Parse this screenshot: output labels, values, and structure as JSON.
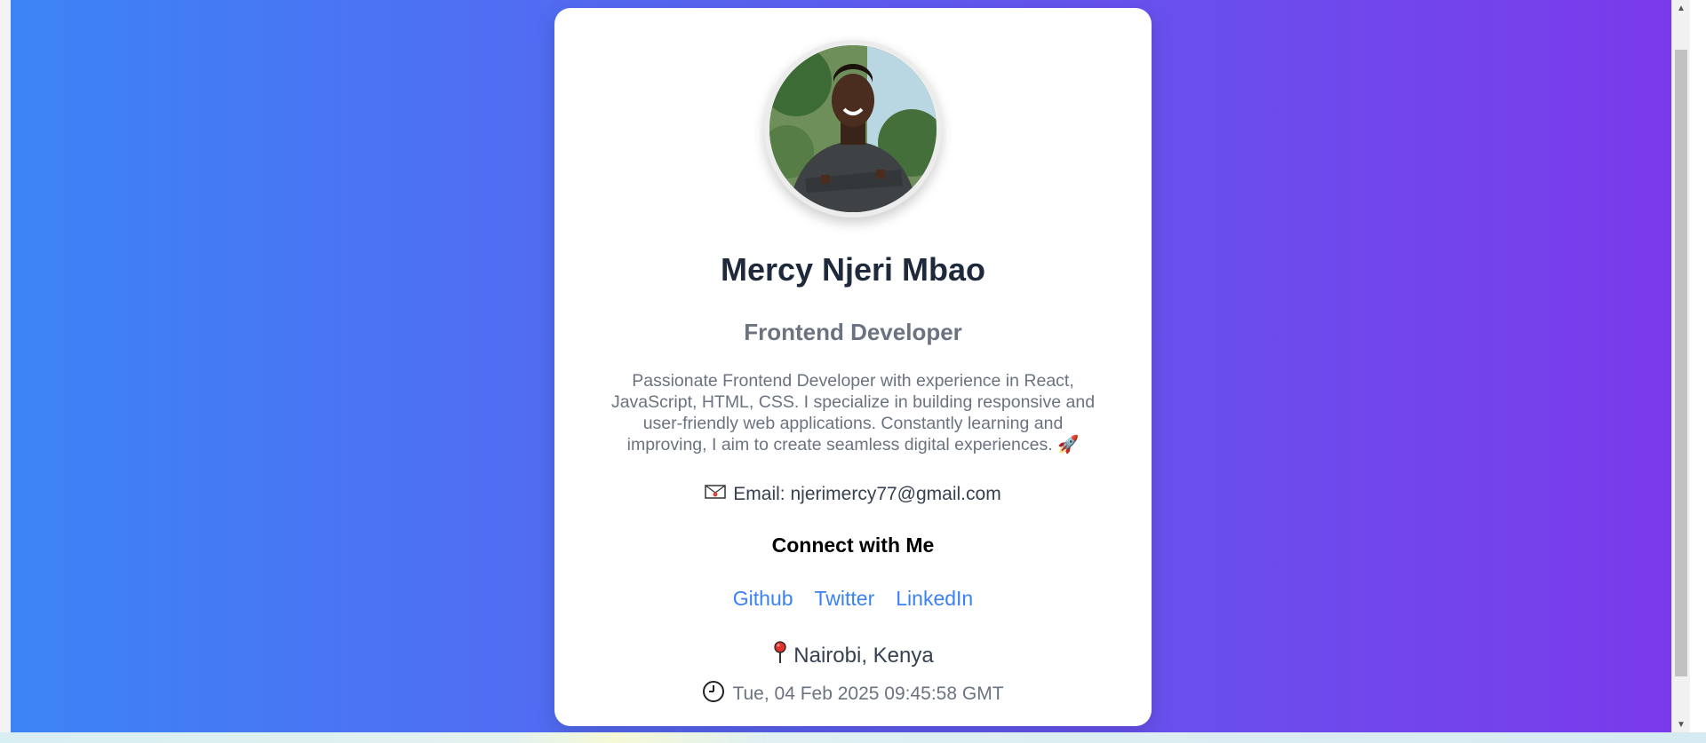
{
  "profile": {
    "name": "Mercy Njeri Mbao",
    "title": "Frontend Developer",
    "bio": "Passionate Frontend Developer with experience in React, JavaScript, HTML, CSS. I specialize in building responsive and user-friendly web applications. Constantly learning and improving, I aim to create seamless digital experiences.",
    "bio_emoji": "🚀",
    "email_text": "Email: njerimercy77@gmail.com",
    "connect_heading": "Connect with Me",
    "links": [
      {
        "label": "Github"
      },
      {
        "label": "Twitter"
      },
      {
        "label": "LinkedIn"
      }
    ],
    "location": "Nairobi, Kenya",
    "time": "Tue, 04 Feb 2025 09:45:58 GMT"
  },
  "icons": {
    "email": "envelope-icon",
    "location": "pushpin-icon",
    "time": "clock-icon"
  },
  "colors": {
    "gradient_start": "#3c84f6",
    "gradient_end": "#7b3aea",
    "link": "#3b82f6",
    "name": "#1e293b",
    "muted": "#6b7280"
  }
}
